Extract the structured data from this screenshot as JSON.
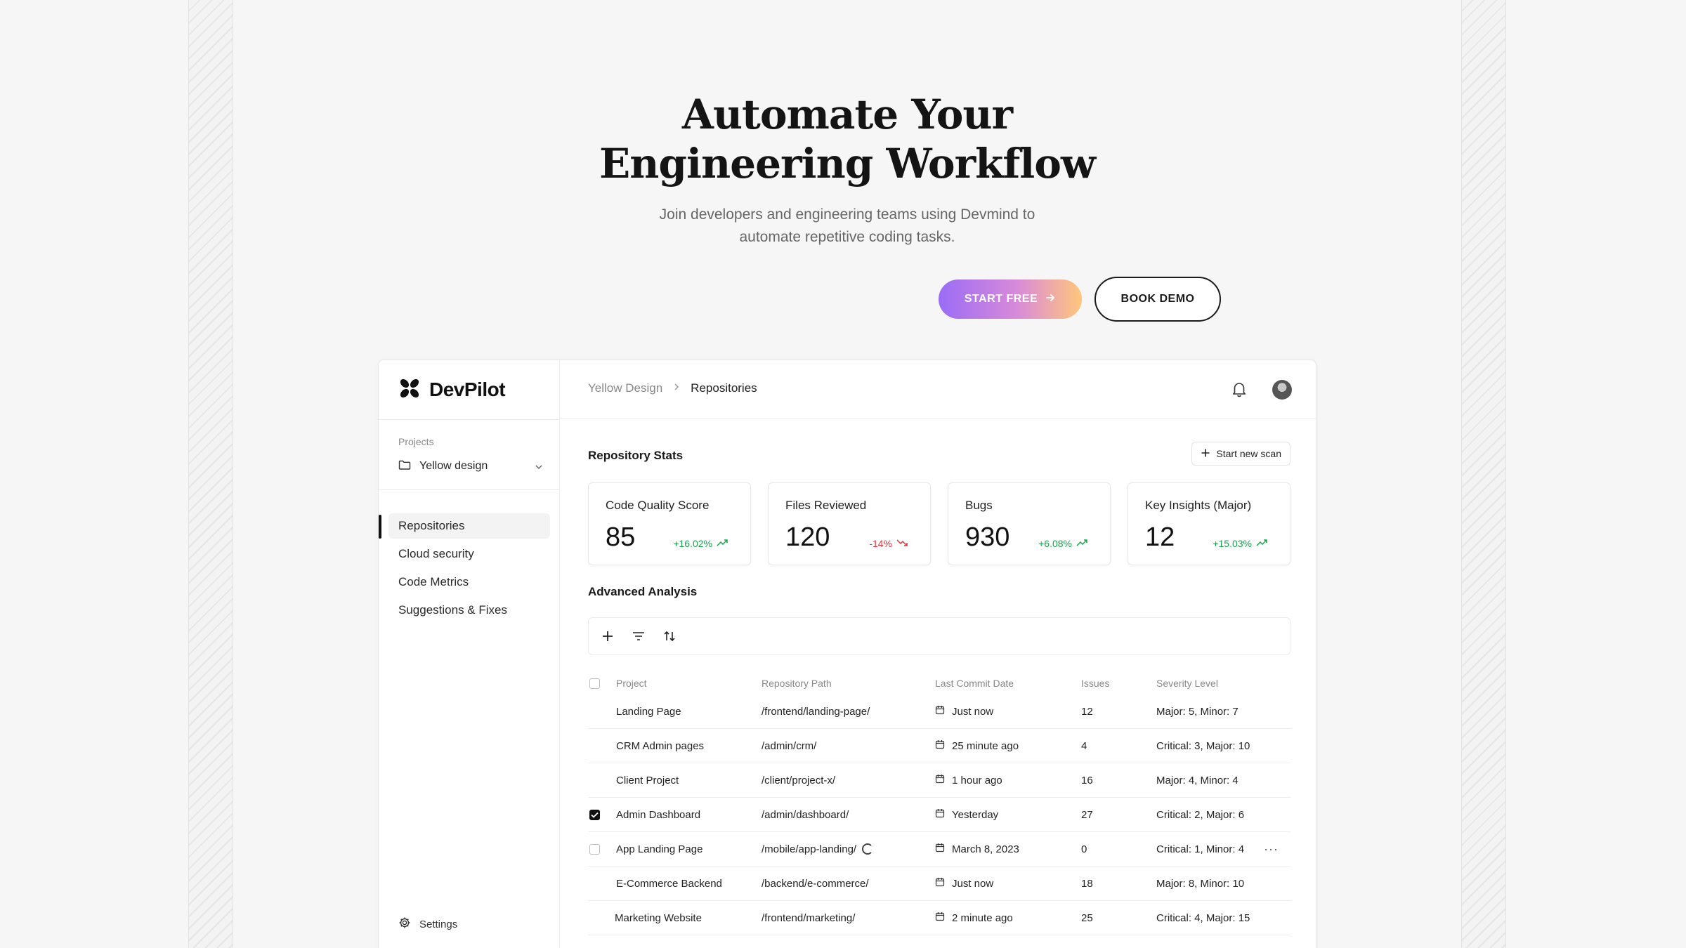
{
  "hero": {
    "title_line1": "Automate Your",
    "title_line2": "Engineering Workflow",
    "subtitle_line1": "Join developers and engineering teams using Devmind to",
    "subtitle_line2": "automate repetitive coding tasks.",
    "start_label": "START FREE",
    "demo_label": "BOOK DEMO"
  },
  "app": {
    "logo_text": "DevPilot",
    "projects_label": "Projects",
    "project_selected": "Yellow design",
    "nav": [
      {
        "label": "Repositories",
        "active": true
      },
      {
        "label": "Cloud security"
      },
      {
        "label": "Code Metrics"
      },
      {
        "label": "Suggestions & Fixes"
      }
    ],
    "settings_label": "Settings",
    "breadcrumb": [
      "Yellow Design",
      "Repositories"
    ],
    "stats_title": "Repository Stats",
    "scan_label": "Start new scan",
    "stats": [
      {
        "label": "Code Quality Score",
        "value": "85",
        "delta": "+16.02%",
        "trend": "up"
      },
      {
        "label": "Files Reviewed",
        "value": "120",
        "delta": "-14%",
        "trend": "down"
      },
      {
        "label": "Bugs",
        "value": "930",
        "delta": "+6.08%",
        "trend": "up"
      },
      {
        "label": "Key Insights (Major)",
        "value": "12",
        "delta": "+15.03%",
        "trend": "up"
      }
    ],
    "analysis_title": "Advanced Analysis",
    "table": {
      "headers": [
        "Project",
        "Repository Path",
        "Last Commit Date",
        "Issues",
        "Severity Level"
      ],
      "rows": [
        {
          "project": "Landing Page",
          "path": "/frontend/landing-page/",
          "date": "Just now",
          "issues": "12",
          "severity": "Major: 5, Minor: 7"
        },
        {
          "project": "CRM Admin pages",
          "path": "/admin/crm/",
          "date": "25 minute ago",
          "issues": "4",
          "severity": "Critical: 3, Major: 10"
        },
        {
          "project": "Client Project",
          "path": "/client/project-x/",
          "date": "1 hour ago",
          "issues": "16",
          "severity": "Major: 4, Minor: 4"
        },
        {
          "project": "Admin Dashboard",
          "path": "/admin/dashboard/",
          "date": "Yesterday",
          "issues": "27",
          "severity": "Critical: 2, Major: 6"
        },
        {
          "project": "App Landing Page",
          "path": "/mobile/app-landing/",
          "date": "March 8, 2023",
          "issues": "0",
          "severity": "Critical: 1, Minor: 4"
        },
        {
          "project": "E-Commerce Backend",
          "path": "/backend/e-commerce/",
          "date": "Just now",
          "issues": "18",
          "severity": "Major: 8, Minor: 10"
        },
        {
          "project": "Marketing Website",
          "path": "/frontend/marketing/",
          "date": "2 minute ago",
          "issues": "25",
          "severity": "Critical: 4, Major: 15"
        }
      ]
    }
  }
}
